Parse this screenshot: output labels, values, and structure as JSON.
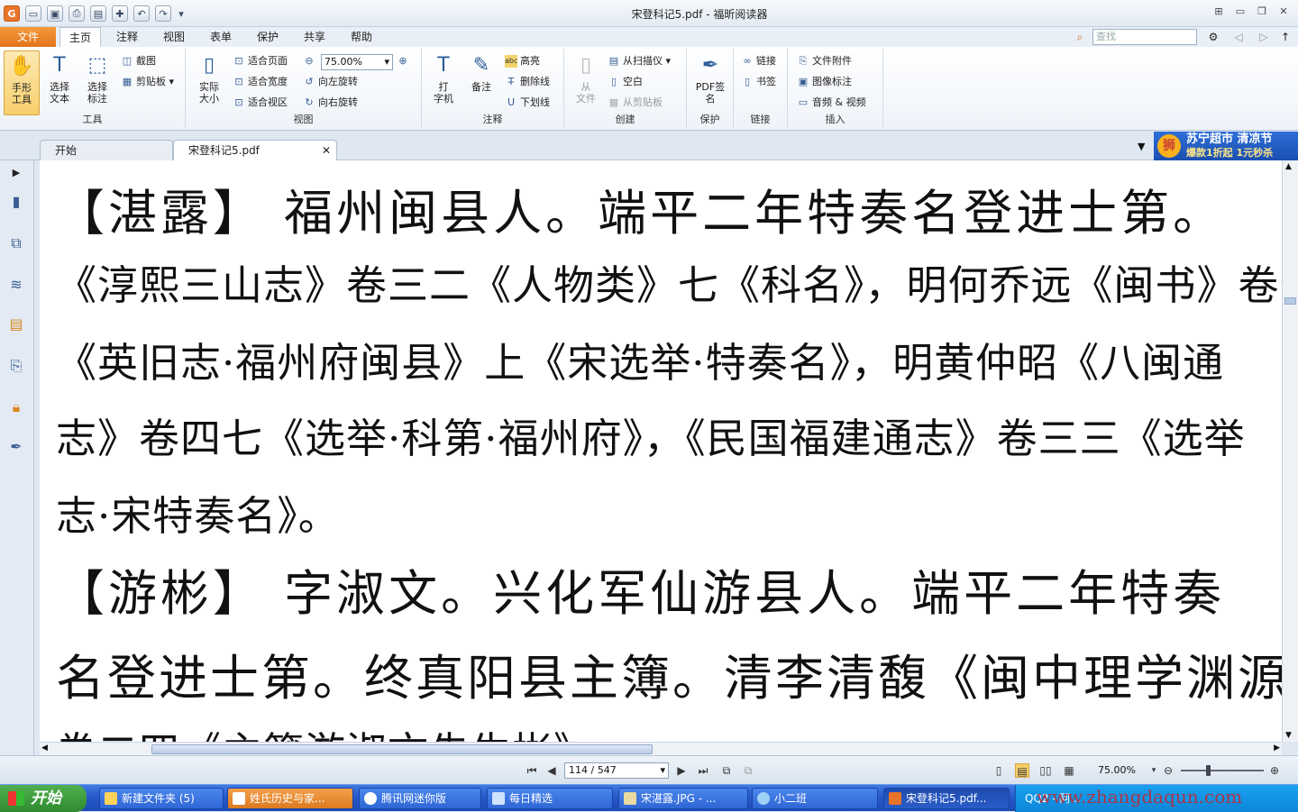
{
  "window": {
    "title": "宋登科记5.pdf - 福昕阅读器"
  },
  "menu": {
    "file": "文件",
    "tabs": [
      "主页",
      "注释",
      "视图",
      "表单",
      "保护",
      "共享",
      "帮助"
    ],
    "search_placeholder": "查找"
  },
  "ribbon": {
    "tools": {
      "hand": "手形\n工具",
      "select_text": "选择\n文本",
      "select_annot": "选择\n标注",
      "screenshot": "截图",
      "clipboard": "剪贴板",
      "label": "工具"
    },
    "view": {
      "actual_size": "实际\n大小",
      "fit_page": "适合页面",
      "fit_width": "适合宽度",
      "fit_visible": "适合视区",
      "zoom": "75.00%",
      "rotate_left": "向左旋转",
      "rotate_right": "向右旋转",
      "label": "视图"
    },
    "annot": {
      "typewriter": "打\n字机",
      "note": "备注",
      "highlight": "高亮",
      "strikeout": "删除线",
      "underline": "下划线",
      "label": "注释"
    },
    "create": {
      "from_file": "从\n文件",
      "from_scanner": "从扫描仪",
      "blank": "空白",
      "from_clipboard": "从剪贴板",
      "label": "创建"
    },
    "protect": {
      "pdf_sign": "PDF签\n名",
      "label": "保护"
    },
    "links": {
      "link": "链接",
      "bookmark": "书签",
      "label": "链接"
    },
    "insert": {
      "attachment": "文件附件",
      "image": "图像标注",
      "audio_video": "音频 & 视频",
      "label": "插入"
    }
  },
  "tabs": {
    "start": "开始",
    "doc": "宋登科记5.pdf"
  },
  "ad": {
    "line1": "苏宁超市 清凉节",
    "line2": "爆款1折起 1元秒杀"
  },
  "document": {
    "lines": [
      "【湛露】  福州闽县人。端平二年特奏名登进士第。",
      "《淳熙三山志》卷三二《人物类》七《科名》，明何乔远《闽书》卷七二",
      "《英旧志·福州府闽县》上《宋选举·特奏名》，明黄仲昭《八闽通",
      "志》卷四七《选举·科第·福州府》，《民国福建通志》卷三三《选举",
      "志·宋特奏名》。",
      "【游彬】  字淑文。兴化军仙游县人。端平二年特奏",
      "名登进士第。终真阳县主簿。清李清馥《闽中理学渊源考》",
      "卷二四《主簿游淑文先生彬》"
    ]
  },
  "status": {
    "page": "114 / 547",
    "zoom": "75.00%"
  },
  "taskbar": {
    "start": "开始",
    "tasks": [
      "新建文件夹 (5)",
      "姓氏历史与家...",
      "腾讯网迷你版",
      "每日精选",
      "宋湛露.JPG - ...",
      "小二班",
      "宋登科记5.pdf...",
      "QQ2 - 阿..."
    ],
    "watermark": "www.zhangdaqun.com"
  }
}
